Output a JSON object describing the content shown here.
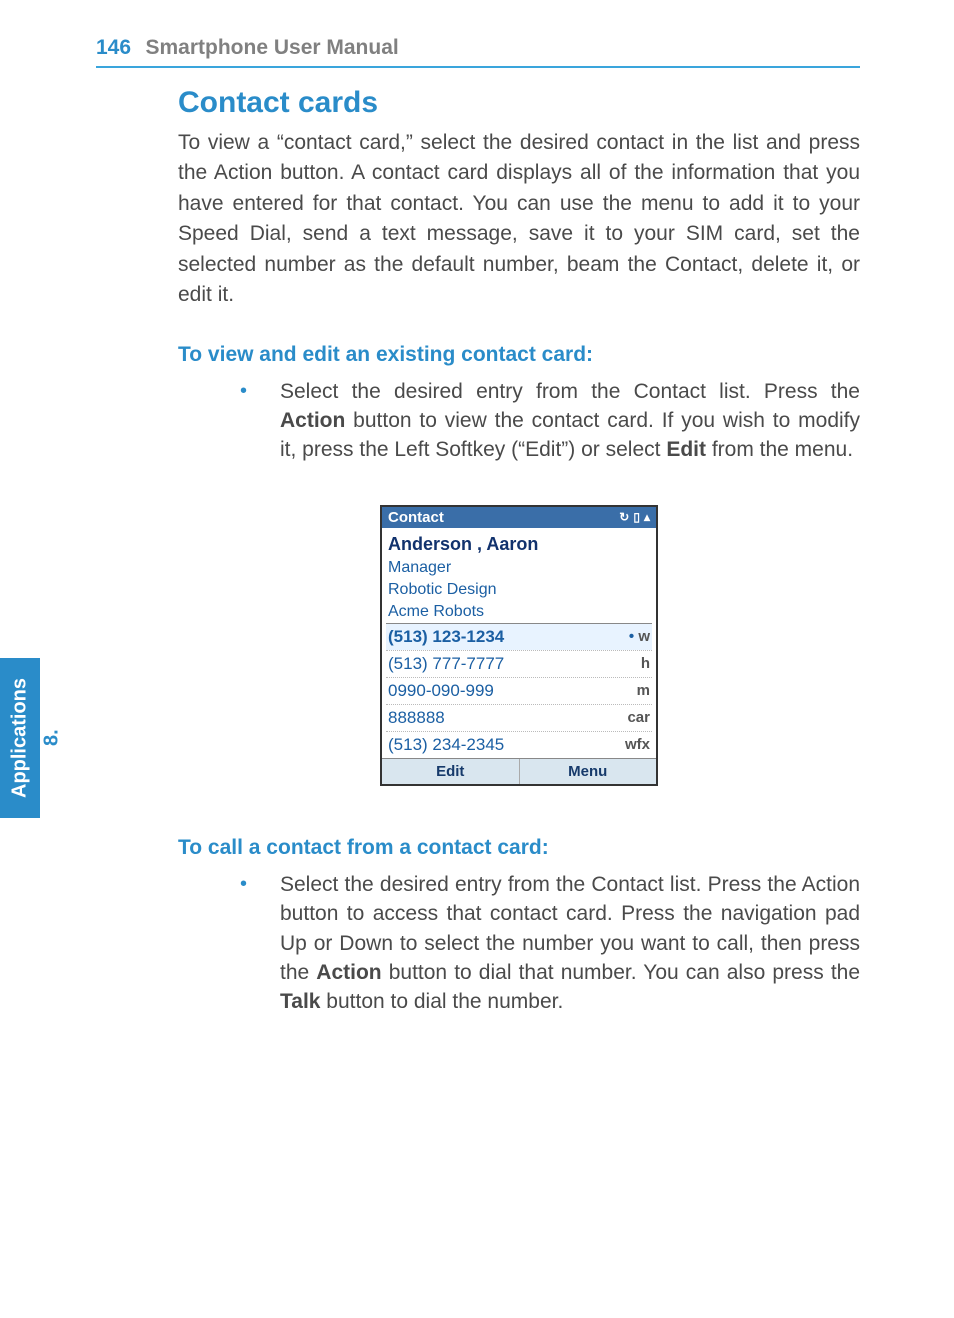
{
  "header": {
    "page_number": "146",
    "book_title": "Smartphone User Manual"
  },
  "side_tab": {
    "number": "8.",
    "label": "Applications"
  },
  "section": {
    "title": "Contact cards",
    "intro": "To view a “contact card,” select the desired contact in the list and press the Action button.  A contact card displays all of the information that you have entered for that contact.  You can use the menu to add it to your Speed Dial, send a text message, save it to your SIM card, set the selected number as the default number, beam the Contact, delete it, or edit it."
  },
  "sub1": {
    "heading": "To view and edit an existing contact card:",
    "bullet_pre": "Select the desired entry from the Contact list.  Press the ",
    "bullet_bold1": "Action",
    "bullet_mid": " button to view the contact card.  If you wish to modify it, press the Left Softkey (“Edit”) or select ",
    "bullet_bold2": "Edit",
    "bullet_post": " from the menu."
  },
  "phone": {
    "title": "Contact",
    "name": "Anderson , Aaron",
    "lines": [
      "Manager",
      "Robotic Design",
      "Acme Robots"
    ],
    "numbers": [
      {
        "num": "(513) 123-1234",
        "tag": "w",
        "selected": true
      },
      {
        "num": "(513) 777-7777",
        "tag": "h",
        "selected": false
      },
      {
        "num": "0990-090-999",
        "tag": "m",
        "selected": false
      },
      {
        "num": "888888",
        "tag": "car",
        "selected": false
      },
      {
        "num": "(513) 234-2345",
        "tag": "wfx",
        "selected": false
      }
    ],
    "soft_left": "Edit",
    "soft_right": "Menu"
  },
  "sub2": {
    "heading": "To call a contact from a contact card:",
    "bullet_pre": "Select the desired entry from the Contact list.  Press the Action button to access that contact card.  Press the navigation pad Up or Down to select the number you want to call, then press the ",
    "bullet_bold1": "Action",
    "bullet_mid": " button to dial that number.  You can also press the ",
    "bullet_bold2": "Talk",
    "bullet_post": " button to dial the number."
  }
}
